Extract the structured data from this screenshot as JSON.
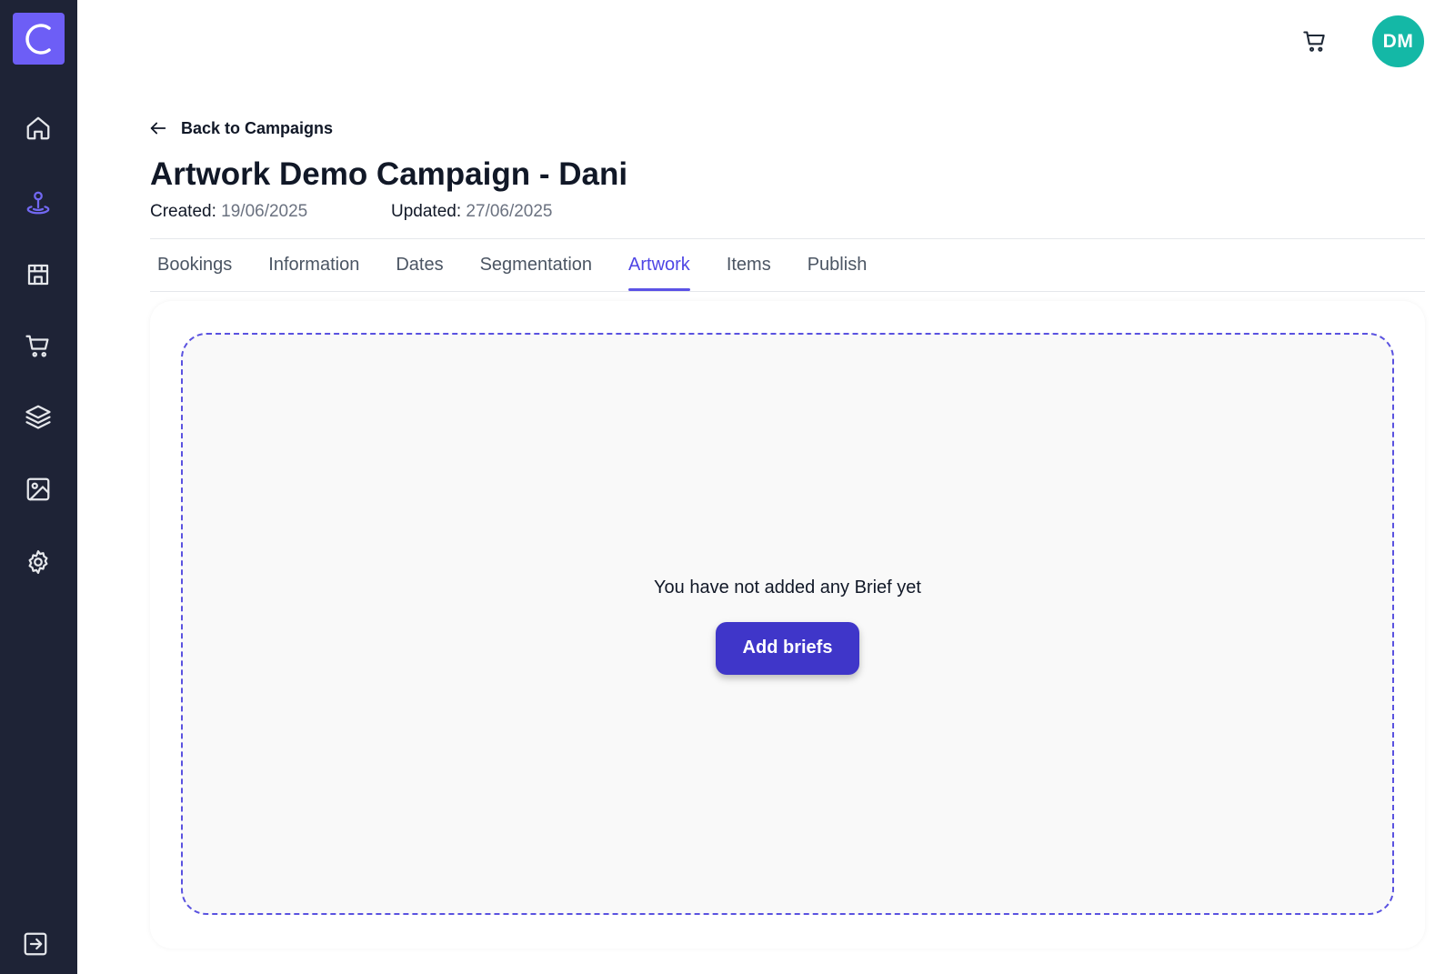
{
  "app": {
    "logo_icon": "c-logo-icon",
    "brand_color": "#6d5ef6",
    "accent_color": "#4f46e5"
  },
  "sidebar": {
    "items": [
      {
        "icon": "home-icon",
        "active": false
      },
      {
        "icon": "campaign-pin-icon",
        "active": true
      },
      {
        "icon": "store-icon",
        "active": false
      },
      {
        "icon": "cart-icon",
        "active": false
      },
      {
        "icon": "layers-icon",
        "active": false
      },
      {
        "icon": "image-icon",
        "active": false
      },
      {
        "icon": "gear-icon",
        "active": false
      }
    ],
    "footer_icon": "logout-icon"
  },
  "topbar": {
    "cart_icon": "cart-icon",
    "avatar_initials": "DM",
    "avatar_color": "#14b8a6"
  },
  "header": {
    "back_label": "Back to Campaigns",
    "title": "Artwork Demo Campaign - Dani",
    "created_label": "Created:",
    "created_value": "19/06/2025",
    "updated_label": "Updated:",
    "updated_value": "27/06/2025"
  },
  "tabs": [
    {
      "label": "Bookings",
      "active": false
    },
    {
      "label": "Information",
      "active": false
    },
    {
      "label": "Dates",
      "active": false
    },
    {
      "label": "Segmentation",
      "active": false
    },
    {
      "label": "Artwork",
      "active": true
    },
    {
      "label": "Items",
      "active": false
    },
    {
      "label": "Publish",
      "active": false
    }
  ],
  "artwork": {
    "empty_message": "You have not added any Brief yet",
    "add_button_label": "Add briefs"
  }
}
